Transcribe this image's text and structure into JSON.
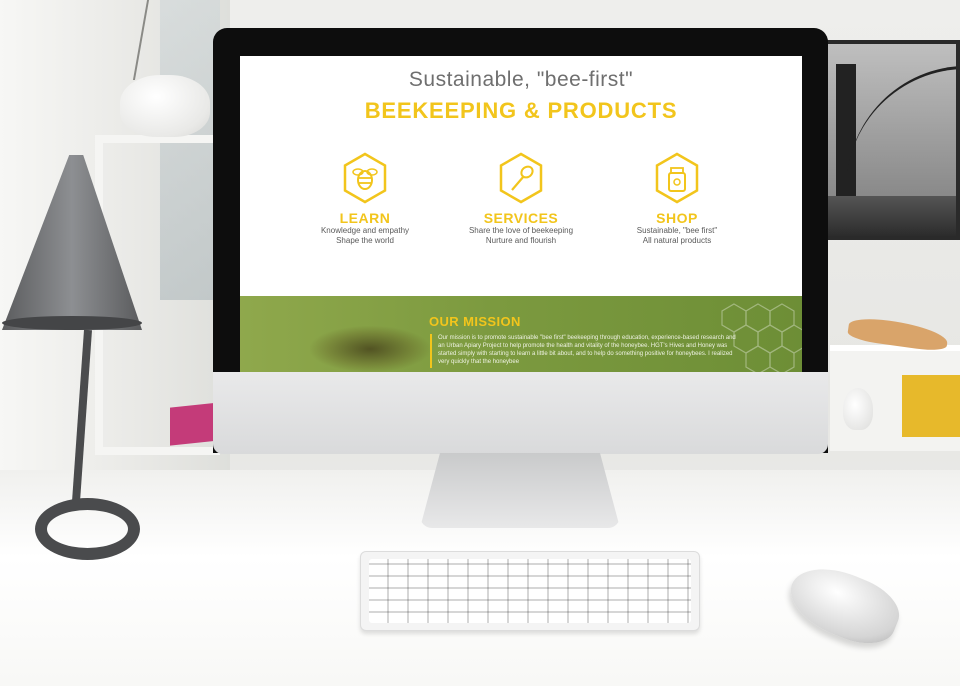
{
  "scene": {
    "accent_color": "#f2c51c",
    "mission_green": "#7c9a3f"
  },
  "website": {
    "hero_subtitle": "Sustainable, \"bee-first\"",
    "hero_title": "BEEKEEPING & PRODUCTS",
    "features": [
      {
        "icon": "bee-icon",
        "title": "LEARN",
        "line1": "Knowledge and empathy",
        "line2": "Shape the world"
      },
      {
        "icon": "honey-dipper-icon",
        "title": "SERVICES",
        "line1": "Share the love of beekeeping",
        "line2": "Nurture and flourish"
      },
      {
        "icon": "honey-jar-icon",
        "title": "SHOP",
        "line1": "Sustainable, \"bee first\"",
        "line2": "All natural products"
      }
    ],
    "mission": {
      "title": "OUR MISSION",
      "text": "Our mission is to promote sustainable \"bee first\" beekeeping through education, experience-based research and an Urban Apiary Project to help promote the health and vitality of the honeybee. HGT's Hives and Honey was started simply with starting to learn a little bit about, and to help do something positive for honeybees. I realized very quickly that the honeybee"
    }
  }
}
